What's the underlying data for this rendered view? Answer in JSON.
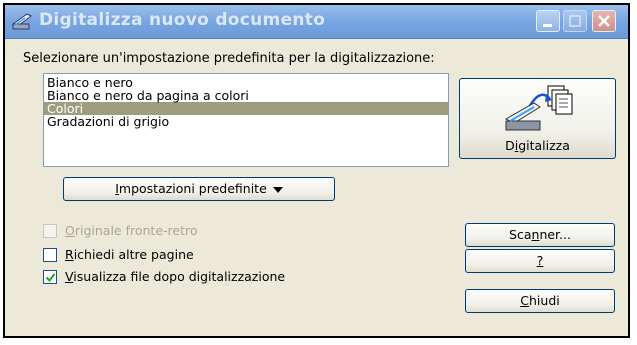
{
  "window": {
    "title": "Digitalizza nuovo documento",
    "icon": "scanner-icon",
    "controls": [
      "minimize-icon",
      "maximize-icon",
      "close-icon"
    ]
  },
  "prompt": "Selezionare un'impostazione predefinita per la digitalizzazione:",
  "presets": {
    "items": [
      "Bianco e nero",
      "Bianco e nero da pagina a colori",
      "Colori",
      "Gradazioni di grigio"
    ],
    "selected": "Colori"
  },
  "buttons": {
    "scan_pre": "D",
    "scan_key": "i",
    "scan_post": "gitalizza",
    "presets_pre": "",
    "presets_key": "I",
    "presets_post": "mpostazioni predefinite",
    "scanner_pre": "Sca",
    "scanner_key": "n",
    "scanner_post": "ner...",
    "help_pre": "",
    "help_key": "?",
    "help_post": "",
    "close_pre": "",
    "close_key": "C",
    "close_post": "hiudi"
  },
  "options": {
    "duplex": {
      "pre": "",
      "key": "O",
      "post": "riginale fronte-retro",
      "checked": false,
      "enabled": false
    },
    "more_pages": {
      "pre": "",
      "key": "R",
      "post": "ichiedi altre pagine",
      "checked": false,
      "enabled": true
    },
    "view_after": {
      "pre": "",
      "key": "V",
      "post": "isualizza file dopo digitalizzazione",
      "checked": true,
      "enabled": true
    }
  },
  "colors": {
    "titlebar": "#7aa7e2",
    "selection": "#9e9e7e",
    "dialog_bg": "#ece9d8",
    "check_green": "#21a121"
  }
}
